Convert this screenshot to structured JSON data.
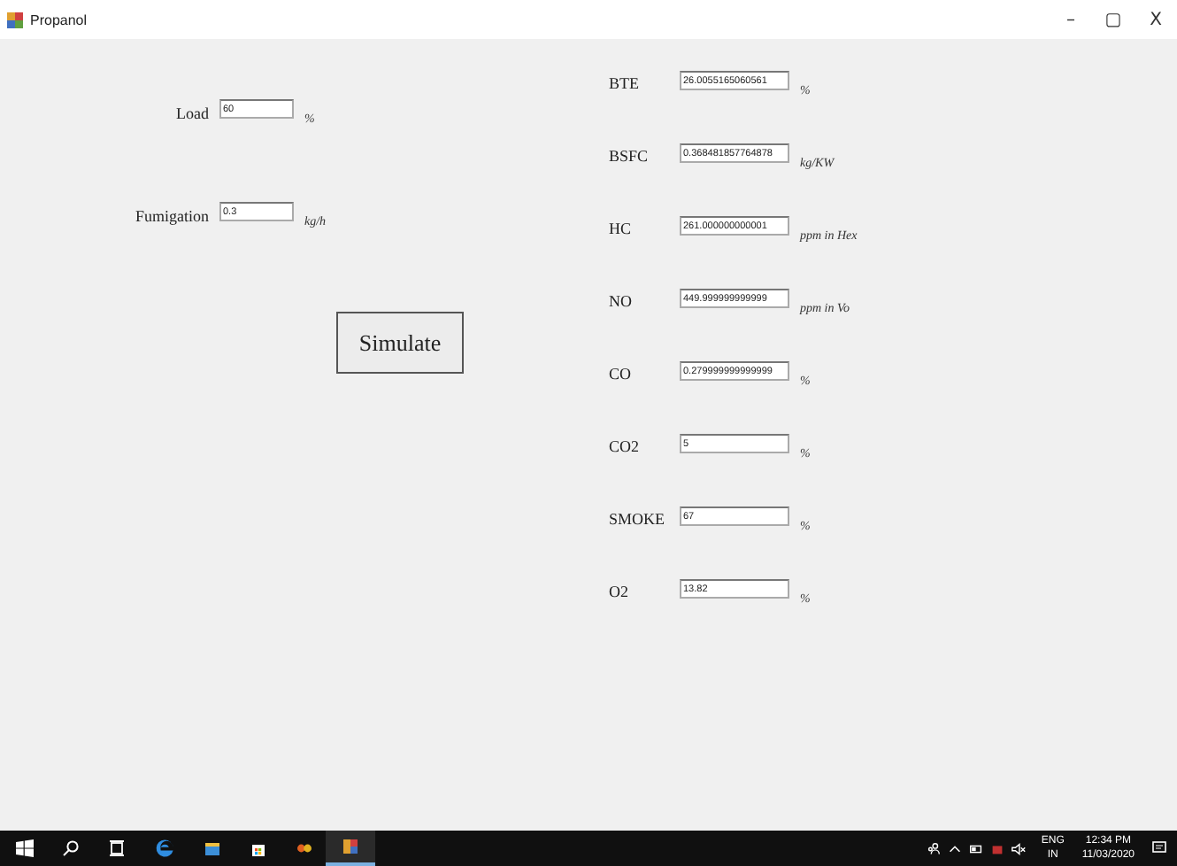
{
  "window": {
    "title": "Propanol",
    "controls": [
      "–",
      "▢",
      "X"
    ]
  },
  "inputs": [
    {
      "label": "Load",
      "value": "60",
      "unit": "%"
    },
    {
      "label": "Fumigation",
      "value": "0.3",
      "unit": "kg/h"
    }
  ],
  "simulate_button": "Simulate",
  "outputs": [
    {
      "label": "BTE",
      "value": "26.0055165060561",
      "unit": "%"
    },
    {
      "label": "BSFC",
      "value": "0.368481857764878",
      "unit": "kg/KW"
    },
    {
      "label": "HC",
      "value": "261.000000000001",
      "unit": "ppm in Hex"
    },
    {
      "label": "NO",
      "value": "449.999999999999",
      "unit": "ppm in Vo"
    },
    {
      "label": "CO",
      "value": "0.279999999999999",
      "unit": "%"
    },
    {
      "label": "CO2",
      "value": "5",
      "unit": "%"
    },
    {
      "label": "SMOKE",
      "value": "67",
      "unit": "%"
    },
    {
      "label": "O2",
      "value": "13.82",
      "unit": "%"
    }
  ],
  "taskbar": {
    "language": "ENG",
    "region": "IN",
    "time": "12:34 PM",
    "date": "11/03/2020"
  }
}
